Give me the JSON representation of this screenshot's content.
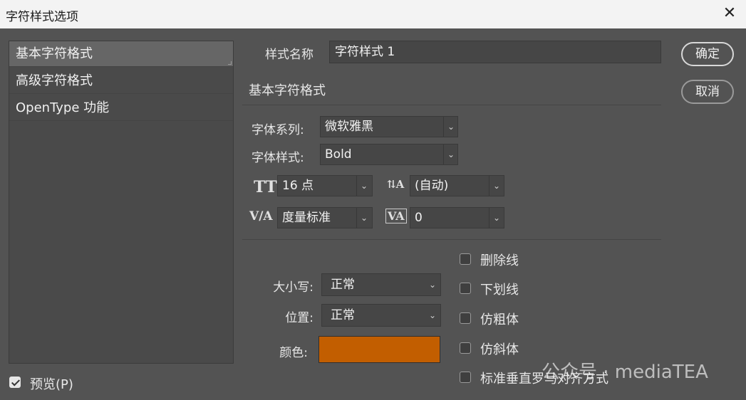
{
  "window": {
    "title": "字符样式选项",
    "close_glyph": "✕"
  },
  "sidebar": {
    "items": [
      {
        "label": "基本字符格式"
      },
      {
        "label": "高级字符格式"
      },
      {
        "label": "OpenType 功能"
      }
    ]
  },
  "style_name": {
    "label": "样式名称",
    "value": "字符样式 1"
  },
  "section": {
    "title": "基本字符格式"
  },
  "font_family": {
    "label": "字体系列:",
    "value": "微软雅黑"
  },
  "font_style": {
    "label": "字体样式:",
    "value": "Bold"
  },
  "font_size": {
    "value": "16 点"
  },
  "leading": {
    "value": "(自动)"
  },
  "kerning": {
    "value": "度量标准"
  },
  "tracking": {
    "value": "0"
  },
  "case": {
    "label": "大小写:",
    "value": "正常"
  },
  "position": {
    "label": "位置:",
    "value": "正常"
  },
  "color": {
    "label": "颜色:",
    "value": "#c25e00"
  },
  "options": [
    {
      "label": "删除线",
      "checked": false
    },
    {
      "label": "下划线",
      "checked": false
    },
    {
      "label": "仿粗体",
      "checked": false
    },
    {
      "label": "仿斜体",
      "checked": false
    },
    {
      "label": "标准垂直罗马对齐方式",
      "checked": false
    }
  ],
  "buttons": {
    "ok": "确定",
    "cancel": "取消"
  },
  "preview": {
    "label": "预览(P)",
    "checked": true
  },
  "watermark": {
    "text": "公众号 · mediaTEA"
  },
  "icons": {
    "dropdown": "chevron-down-icon",
    "font_size": "font-size-icon",
    "leading": "leading-icon",
    "kerning": "kerning-icon",
    "tracking": "tracking-icon"
  }
}
